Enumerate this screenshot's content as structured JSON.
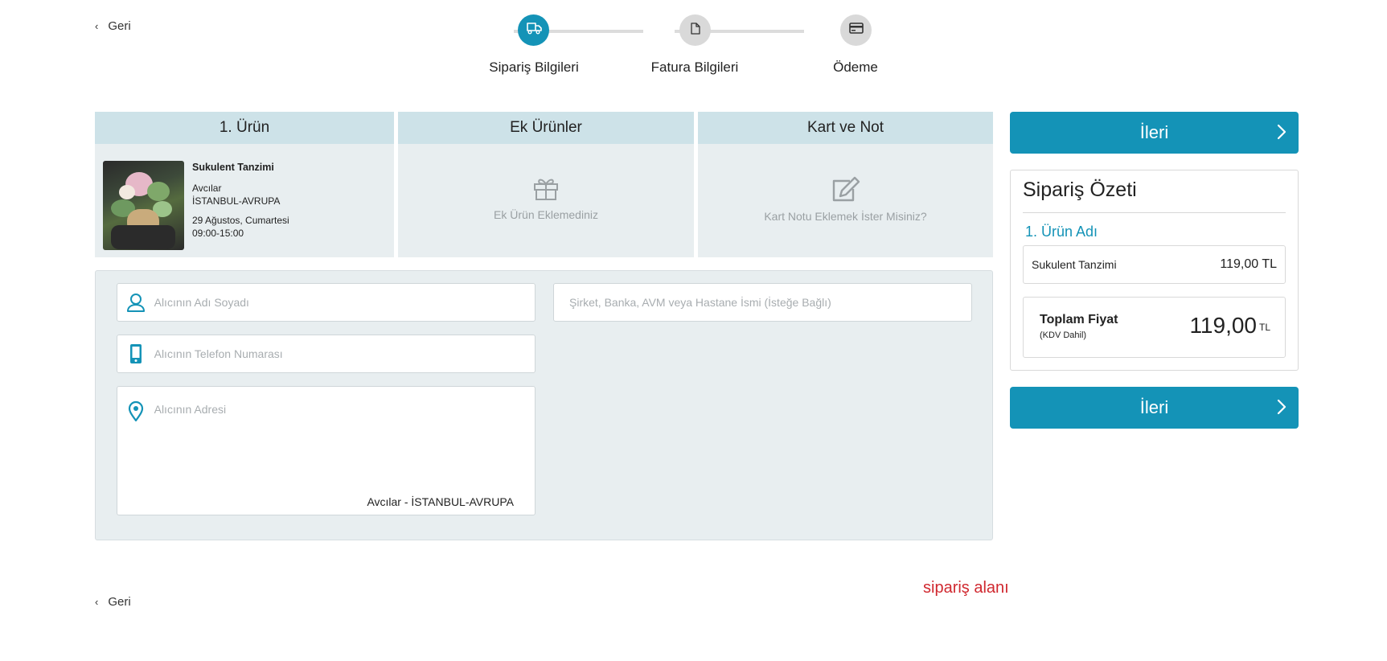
{
  "nav": {
    "back_label": "Geri"
  },
  "stepper": {
    "steps": [
      {
        "label": "Sipariş Bilgileri",
        "icon": "truck-icon",
        "active": true
      },
      {
        "label": "Fatura Bilgileri",
        "icon": "document-icon",
        "active": false
      },
      {
        "label": "Ödeme",
        "icon": "credit-card-icon",
        "active": false
      }
    ]
  },
  "tabs": {
    "product": {
      "header": "1. Ürün",
      "name": "Sukulent Tanzimi",
      "district": "Avcılar",
      "city": "İSTANBUL-AVRUPA",
      "date": "29 Ağustos, Cumartesi",
      "time": "09:00-15:00"
    },
    "extras": {
      "header": "Ek Ürünler",
      "empty_text": "Ek Ürün Eklemediniz"
    },
    "card": {
      "header": "Kart ve Not",
      "empty_text": "Kart Notu Eklemek İster Misiniz?"
    }
  },
  "form": {
    "name_placeholder": "Alıcının Adı Soyadı",
    "company_placeholder": "Şirket, Banka, AVM veya Hastane İsmi (İsteğe Bağlı)",
    "phone_placeholder": "Alıcının Telefon Numarası",
    "address_placeholder": "Alıcının Adresi",
    "address_location": "Avcılar - İSTANBUL-AVRUPA"
  },
  "sidebar": {
    "next_label": "İleri",
    "summary_title": "Sipariş Özeti",
    "item_header": "1. Ürün Adı",
    "item_name": "Sukulent Tanzimi",
    "item_price": "119,00 TL",
    "total_label": "Toplam Fiyat",
    "total_note": "(KDV Dahil)",
    "total_value": "119,00",
    "total_currency": "TL"
  },
  "annotation": "sipariş alanı",
  "colors": {
    "accent": "#1493b7",
    "tab_header": "#cde2e8",
    "panel_bg": "#e8eef0",
    "annotation": "#d0282f"
  }
}
